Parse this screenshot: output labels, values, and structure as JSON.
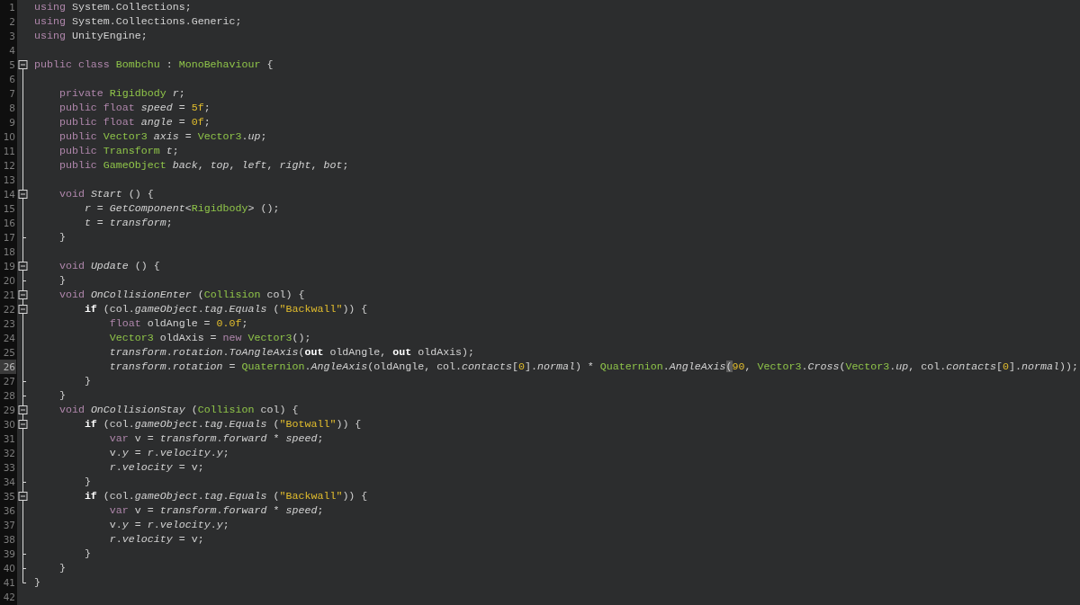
{
  "editor": {
    "lines": [
      {
        "number": "1",
        "kind": "none",
        "current": false,
        "tokens": [
          {
            "kind": "keyword",
            "text": "using"
          },
          {
            "kind": "plain",
            "text": " System.Collections;"
          }
        ]
      },
      {
        "number": "2",
        "kind": "none",
        "current": false,
        "tokens": [
          {
            "kind": "keyword",
            "text": "using"
          },
          {
            "kind": "plain",
            "text": " System.Collections.Generic;"
          }
        ]
      },
      {
        "number": "3",
        "kind": "none",
        "current": false,
        "tokens": [
          {
            "kind": "keyword",
            "text": "using"
          },
          {
            "kind": "plain",
            "text": " UnityEngine;"
          }
        ]
      },
      {
        "number": "4",
        "kind": "none",
        "current": false
      },
      {
        "number": "5",
        "kind": "opener",
        "current": false,
        "tokens": [
          {
            "kind": "keyword",
            "text": "public class "
          },
          {
            "kind": "type",
            "text": "Bombchu"
          },
          {
            "kind": "plain",
            "text": " : "
          },
          {
            "kind": "type",
            "text": "MonoBehaviour"
          },
          {
            "kind": "plain",
            "text": " {"
          }
        ]
      },
      {
        "number": "6",
        "kind": "body",
        "current": false
      },
      {
        "number": "7",
        "kind": "body",
        "current": false,
        "tokens": [
          {
            "kind": "keyword",
            "text": "    private "
          },
          {
            "kind": "type",
            "text": "Rigidbody "
          },
          {
            "kind": "ident",
            "text": "r"
          },
          {
            "kind": "plain",
            "text": ";"
          }
        ]
      },
      {
        "number": "8",
        "kind": "body",
        "current": false,
        "tokens": [
          {
            "kind": "keyword",
            "text": "    public float "
          },
          {
            "kind": "ident",
            "text": "speed"
          },
          {
            "kind": "plain",
            "text": " = "
          },
          {
            "kind": "literal",
            "text": "5f"
          },
          {
            "kind": "plain",
            "text": ";"
          }
        ]
      },
      {
        "number": "9",
        "kind": "body",
        "current": false,
        "tokens": [
          {
            "kind": "keyword",
            "text": "    public float "
          },
          {
            "kind": "ident",
            "text": "angle"
          },
          {
            "kind": "plain",
            "text": " = "
          },
          {
            "kind": "literal",
            "text": "0f"
          },
          {
            "kind": "plain",
            "text": ";"
          }
        ]
      },
      {
        "number": "10",
        "kind": "body",
        "current": false,
        "tokens": [
          {
            "kind": "keyword",
            "text": "    public "
          },
          {
            "kind": "type",
            "text": "Vector3 "
          },
          {
            "kind": "ident",
            "text": "axis"
          },
          {
            "kind": "plain",
            "text": " = "
          },
          {
            "kind": "type",
            "text": "Vector3"
          },
          {
            "kind": "plain",
            "text": "."
          },
          {
            "kind": "ident",
            "text": "up"
          },
          {
            "kind": "plain",
            "text": ";"
          }
        ]
      },
      {
        "number": "11",
        "kind": "body",
        "current": false,
        "tokens": [
          {
            "kind": "keyword",
            "text": "    public "
          },
          {
            "kind": "type",
            "text": "Transform "
          },
          {
            "kind": "ident",
            "text": "t"
          },
          {
            "kind": "plain",
            "text": ";"
          }
        ]
      },
      {
        "number": "12",
        "kind": "body",
        "current": false,
        "tokens": [
          {
            "kind": "keyword",
            "text": "    public "
          },
          {
            "kind": "type",
            "text": "GameObject "
          },
          {
            "kind": "ident",
            "text": "back"
          },
          {
            "kind": "plain",
            "text": ", "
          },
          {
            "kind": "ident",
            "text": "top"
          },
          {
            "kind": "plain",
            "text": ", "
          },
          {
            "kind": "ident",
            "text": "left"
          },
          {
            "kind": "plain",
            "text": ", "
          },
          {
            "kind": "ident",
            "text": "right"
          },
          {
            "kind": "plain",
            "text": ", "
          },
          {
            "kind": "ident",
            "text": "bot"
          },
          {
            "kind": "plain",
            "text": ";"
          }
        ]
      },
      {
        "number": "13",
        "kind": "body",
        "current": false
      },
      {
        "number": "14",
        "kind": "opener",
        "current": false,
        "tokens": [
          {
            "kind": "keyword",
            "text": "    void "
          },
          {
            "kind": "ident",
            "text": "Start"
          },
          {
            "kind": "plain",
            "text": " () {"
          }
        ]
      },
      {
        "number": "15",
        "kind": "body",
        "current": false,
        "tokens": [
          {
            "kind": "ident",
            "text": "        r"
          },
          {
            "kind": "plain",
            "text": " = "
          },
          {
            "kind": "ident",
            "text": "GetComponent"
          },
          {
            "kind": "plain",
            "text": "<"
          },
          {
            "kind": "type",
            "text": "Rigidbody"
          },
          {
            "kind": "plain",
            "text": "> ();"
          }
        ]
      },
      {
        "number": "16",
        "kind": "body",
        "current": false,
        "tokens": [
          {
            "kind": "ident",
            "text": "        t"
          },
          {
            "kind": "plain",
            "text": " = "
          },
          {
            "kind": "ident",
            "text": "transform"
          },
          {
            "kind": "plain",
            "text": ";"
          }
        ]
      },
      {
        "number": "17",
        "kind": "closer",
        "current": false,
        "tokens": [
          {
            "kind": "plain",
            "text": "    }"
          }
        ]
      },
      {
        "number": "18",
        "kind": "body",
        "current": false
      },
      {
        "number": "19",
        "kind": "opener",
        "current": false,
        "tokens": [
          {
            "kind": "keyword",
            "text": "    void "
          },
          {
            "kind": "ident",
            "text": "Update"
          },
          {
            "kind": "plain",
            "text": " () {"
          }
        ]
      },
      {
        "number": "20",
        "kind": "closer",
        "current": false,
        "tokens": [
          {
            "kind": "plain",
            "text": "    }"
          }
        ]
      },
      {
        "number": "21",
        "kind": "opener",
        "current": false,
        "tokens": [
          {
            "kind": "keyword",
            "text": "    void "
          },
          {
            "kind": "ident",
            "text": "OnCollisionEnter"
          },
          {
            "kind": "plain",
            "text": " ("
          },
          {
            "kind": "type",
            "text": "Collision"
          },
          {
            "kind": "plain",
            "text": " col) {"
          }
        ]
      },
      {
        "number": "22",
        "kind": "opener",
        "current": false,
        "tokens": [
          {
            "kind": "control",
            "text": "        if"
          },
          {
            "kind": "plain",
            "text": " (col."
          },
          {
            "kind": "ident",
            "text": "gameObject"
          },
          {
            "kind": "plain",
            "text": "."
          },
          {
            "kind": "ident",
            "text": "tag"
          },
          {
            "kind": "plain",
            "text": "."
          },
          {
            "kind": "ident",
            "text": "Equals"
          },
          {
            "kind": "plain",
            "text": " ("
          },
          {
            "kind": "literal",
            "text": "\"Backwall\""
          },
          {
            "kind": "plain",
            "text": ")) {"
          }
        ]
      },
      {
        "number": "23",
        "kind": "body",
        "current": false,
        "tokens": [
          {
            "kind": "keyword",
            "text": "            float"
          },
          {
            "kind": "plain",
            "text": " oldAngle = "
          },
          {
            "kind": "literal",
            "text": "0.0f"
          },
          {
            "kind": "plain",
            "text": ";"
          }
        ]
      },
      {
        "number": "24",
        "kind": "body",
        "current": false,
        "tokens": [
          {
            "kind": "type",
            "text": "            Vector3"
          },
          {
            "kind": "plain",
            "text": " oldAxis = "
          },
          {
            "kind": "keyword",
            "text": "new "
          },
          {
            "kind": "type",
            "text": "Vector3"
          },
          {
            "kind": "plain",
            "text": "();"
          }
        ]
      },
      {
        "number": "25",
        "kind": "body",
        "current": false,
        "tokens": [
          {
            "kind": "ident",
            "text": "            transform"
          },
          {
            "kind": "plain",
            "text": "."
          },
          {
            "kind": "ident",
            "text": "rotation"
          },
          {
            "kind": "plain",
            "text": "."
          },
          {
            "kind": "ident",
            "text": "ToAngleAxis"
          },
          {
            "kind": "plain",
            "text": "("
          },
          {
            "kind": "control",
            "text": "out"
          },
          {
            "kind": "plain",
            "text": " oldAngle, "
          },
          {
            "kind": "control",
            "text": "out"
          },
          {
            "kind": "plain",
            "text": " oldAxis);"
          }
        ]
      },
      {
        "number": "26",
        "kind": "body",
        "current": true,
        "tokens": [
          {
            "kind": "ident",
            "text": "            transform"
          },
          {
            "kind": "plain",
            "text": "."
          },
          {
            "kind": "ident",
            "text": "rotation"
          },
          {
            "kind": "plain",
            "text": " = "
          },
          {
            "kind": "type",
            "text": "Quaternion"
          },
          {
            "kind": "plain",
            "text": "."
          },
          {
            "kind": "ident",
            "text": "AngleAxis"
          },
          {
            "kind": "plain",
            "text": "(oldAngle, col."
          },
          {
            "kind": "ident",
            "text": "contacts"
          },
          {
            "kind": "plain",
            "text": "["
          },
          {
            "kind": "literal",
            "text": "0"
          },
          {
            "kind": "plain",
            "text": "]."
          },
          {
            "kind": "ident",
            "text": "normal"
          },
          {
            "kind": "plain",
            "text": ") * "
          },
          {
            "kind": "type",
            "text": "Quaternion"
          },
          {
            "kind": "plain",
            "text": "."
          },
          {
            "kind": "ident",
            "text": "AngleAxis"
          },
          {
            "kind": "match",
            "text": "("
          },
          {
            "kind": "literal",
            "text": "90"
          },
          {
            "kind": "plain",
            "text": ", "
          },
          {
            "kind": "type",
            "text": "Vector3"
          },
          {
            "kind": "plain",
            "text": "."
          },
          {
            "kind": "ident",
            "text": "Cross"
          },
          {
            "kind": "plain",
            "text": "("
          },
          {
            "kind": "type",
            "text": "Vector3"
          },
          {
            "kind": "plain",
            "text": "."
          },
          {
            "kind": "ident",
            "text": "up"
          },
          {
            "kind": "plain",
            "text": ", col."
          },
          {
            "kind": "ident",
            "text": "contacts"
          },
          {
            "kind": "plain",
            "text": "["
          },
          {
            "kind": "literal",
            "text": "0"
          },
          {
            "kind": "plain",
            "text": "]."
          },
          {
            "kind": "ident",
            "text": "normal"
          },
          {
            "kind": "plain",
            "text": "));"
          }
        ]
      },
      {
        "number": "27",
        "kind": "closer",
        "current": false,
        "tokens": [
          {
            "kind": "plain",
            "text": "        }"
          }
        ]
      },
      {
        "number": "28",
        "kind": "closer",
        "current": false,
        "tokens": [
          {
            "kind": "plain",
            "text": "    }"
          }
        ]
      },
      {
        "number": "29",
        "kind": "opener",
        "current": false,
        "tokens": [
          {
            "kind": "keyword",
            "text": "    void "
          },
          {
            "kind": "ident",
            "text": "OnCollisionStay"
          },
          {
            "kind": "plain",
            "text": " ("
          },
          {
            "kind": "type",
            "text": "Collision"
          },
          {
            "kind": "plain",
            "text": " col) {"
          }
        ]
      },
      {
        "number": "30",
        "kind": "opener",
        "current": false,
        "tokens": [
          {
            "kind": "control",
            "text": "        if"
          },
          {
            "kind": "plain",
            "text": " (col."
          },
          {
            "kind": "ident",
            "text": "gameObject"
          },
          {
            "kind": "plain",
            "text": "."
          },
          {
            "kind": "ident",
            "text": "tag"
          },
          {
            "kind": "plain",
            "text": "."
          },
          {
            "kind": "ident",
            "text": "Equals"
          },
          {
            "kind": "plain",
            "text": " ("
          },
          {
            "kind": "literal",
            "text": "\"Botwall\""
          },
          {
            "kind": "plain",
            "text": ")) {"
          }
        ]
      },
      {
        "number": "31",
        "kind": "body",
        "current": false,
        "tokens": [
          {
            "kind": "keyword",
            "text": "            var"
          },
          {
            "kind": "plain",
            "text": " v = "
          },
          {
            "kind": "ident",
            "text": "transform"
          },
          {
            "kind": "plain",
            "text": "."
          },
          {
            "kind": "ident",
            "text": "forward"
          },
          {
            "kind": "plain",
            "text": " * "
          },
          {
            "kind": "ident",
            "text": "speed"
          },
          {
            "kind": "plain",
            "text": ";"
          }
        ]
      },
      {
        "number": "32",
        "kind": "body",
        "current": false,
        "tokens": [
          {
            "kind": "plain",
            "text": "            v."
          },
          {
            "kind": "ident",
            "text": "y"
          },
          {
            "kind": "plain",
            "text": " = "
          },
          {
            "kind": "ident",
            "text": "r"
          },
          {
            "kind": "plain",
            "text": "."
          },
          {
            "kind": "ident",
            "text": "velocity"
          },
          {
            "kind": "plain",
            "text": "."
          },
          {
            "kind": "ident",
            "text": "y"
          },
          {
            "kind": "plain",
            "text": ";"
          }
        ]
      },
      {
        "number": "33",
        "kind": "body",
        "current": false,
        "tokens": [
          {
            "kind": "ident",
            "text": "            r"
          },
          {
            "kind": "plain",
            "text": "."
          },
          {
            "kind": "ident",
            "text": "velocity"
          },
          {
            "kind": "plain",
            "text": " = v;"
          }
        ]
      },
      {
        "number": "34",
        "kind": "closer",
        "current": false,
        "tokens": [
          {
            "kind": "plain",
            "text": "        }"
          }
        ]
      },
      {
        "number": "35",
        "kind": "opener",
        "current": false,
        "tokens": [
          {
            "kind": "control",
            "text": "        if"
          },
          {
            "kind": "plain",
            "text": " (col."
          },
          {
            "kind": "ident",
            "text": "gameObject"
          },
          {
            "kind": "plain",
            "text": "."
          },
          {
            "kind": "ident",
            "text": "tag"
          },
          {
            "kind": "plain",
            "text": "."
          },
          {
            "kind": "ident",
            "text": "Equals"
          },
          {
            "kind": "plain",
            "text": " ("
          },
          {
            "kind": "literal",
            "text": "\"Backwall\""
          },
          {
            "kind": "plain",
            "text": ")) {"
          }
        ]
      },
      {
        "number": "36",
        "kind": "body",
        "current": false,
        "tokens": [
          {
            "kind": "keyword",
            "text": "            var"
          },
          {
            "kind": "plain",
            "text": " v = "
          },
          {
            "kind": "ident",
            "text": "transform"
          },
          {
            "kind": "plain",
            "text": "."
          },
          {
            "kind": "ident",
            "text": "forward"
          },
          {
            "kind": "plain",
            "text": " * "
          },
          {
            "kind": "ident",
            "text": "speed"
          },
          {
            "kind": "plain",
            "text": ";"
          }
        ]
      },
      {
        "number": "37",
        "kind": "body",
        "current": false,
        "tokens": [
          {
            "kind": "plain",
            "text": "            v."
          },
          {
            "kind": "ident",
            "text": "y"
          },
          {
            "kind": "plain",
            "text": " = "
          },
          {
            "kind": "ident",
            "text": "r"
          },
          {
            "kind": "plain",
            "text": "."
          },
          {
            "kind": "ident",
            "text": "velocity"
          },
          {
            "kind": "plain",
            "text": "."
          },
          {
            "kind": "ident",
            "text": "y"
          },
          {
            "kind": "plain",
            "text": ";"
          }
        ]
      },
      {
        "number": "38",
        "kind": "body",
        "current": false,
        "tokens": [
          {
            "kind": "ident",
            "text": "            r"
          },
          {
            "kind": "plain",
            "text": "."
          },
          {
            "kind": "ident",
            "text": "velocity"
          },
          {
            "kind": "plain",
            "text": " = v;"
          }
        ]
      },
      {
        "number": "39",
        "kind": "closer",
        "current": false,
        "tokens": [
          {
            "kind": "plain",
            "text": "        }"
          }
        ]
      },
      {
        "number": "40",
        "kind": "closer",
        "current": false,
        "tokens": [
          {
            "kind": "plain",
            "text": "    }"
          }
        ]
      },
      {
        "number": "41",
        "kind": "final",
        "current": false,
        "tokens": [
          {
            "kind": "plain",
            "text": "}"
          }
        ]
      },
      {
        "number": "42",
        "kind": "none",
        "current": false
      }
    ]
  }
}
